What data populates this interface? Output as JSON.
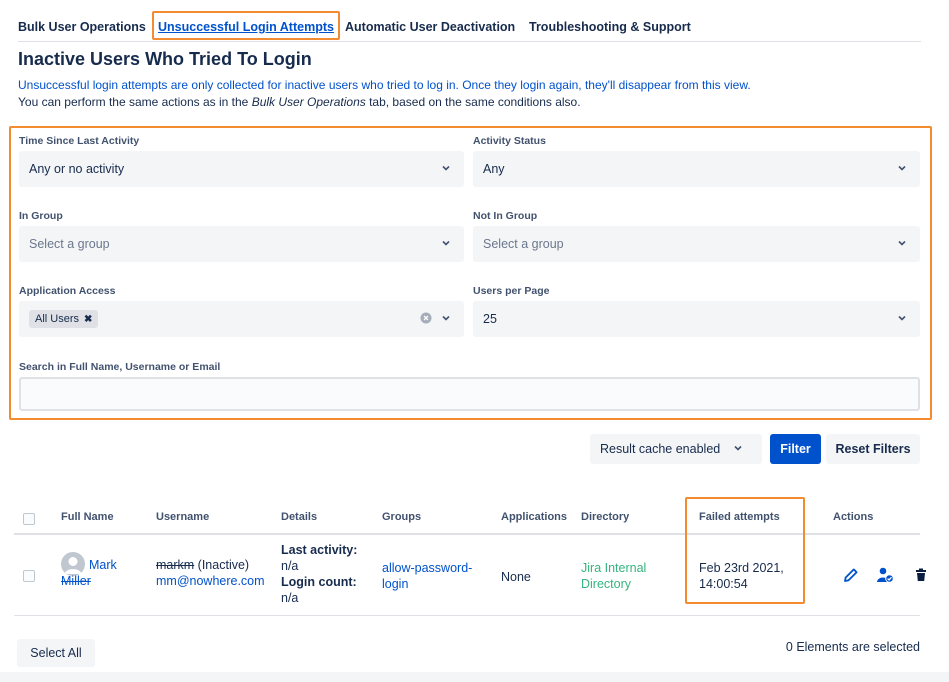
{
  "tabs": [
    {
      "label": "Bulk User Operations",
      "active": false
    },
    {
      "label": "Unsuccessful Login Attempts",
      "active": true
    },
    {
      "label": "Automatic User Deactivation",
      "active": false
    },
    {
      "label": "Troubleshooting & Support",
      "active": false
    }
  ],
  "page": {
    "title": "Inactive Users Who Tried To Login",
    "info_line_1": "Unsuccessful login attempts are only collected for inactive users who tried to log in. Once they login again, they'll disappear from this view.",
    "info_line_2_prefix": "You can perform the same actions as in the ",
    "info_line_2_emph": "Bulk User Operations",
    "info_line_2_suffix": " tab, based on the same conditions also."
  },
  "filters": {
    "time_since_label": "Time Since Last Activity",
    "time_since_value": "Any or no activity",
    "activity_status_label": "Activity Status",
    "activity_status_value": "Any",
    "in_group_label": "In Group",
    "in_group_placeholder": "Select a group",
    "not_in_group_label": "Not In Group",
    "not_in_group_placeholder": "Select a group",
    "app_access_label": "Application Access",
    "app_access_chip": "All Users",
    "users_per_page_label": "Users per Page",
    "users_per_page_value": "25",
    "search_label": "Search in Full Name, Username or Email",
    "search_value": ""
  },
  "toolbar": {
    "cache_label": "Result cache enabled",
    "filter_label": "Filter",
    "reset_label": "Reset Filters"
  },
  "table": {
    "headers": [
      "Full Name",
      "Username",
      "Details",
      "Groups",
      "Applications",
      "Directory",
      "Failed attempts",
      "Actions"
    ],
    "rows": [
      {
        "full_name_first": "Mark",
        "full_name_last": "Miller",
        "username": "markm",
        "username_status": " (Inactive)",
        "email": "mm@nowhere.com",
        "last_activity_label": "Last activity:",
        "last_activity_value": "n/a",
        "login_count_label": "Login count:",
        "login_count_value": "n/a",
        "group_line_1": "allow-password-",
        "group_line_2": "login",
        "applications": "None",
        "directory_line_1": "Jira Internal",
        "directory_line_2": "Directory",
        "failed_line_1": "Feb 23rd 2021,",
        "failed_line_2": "14:00:54"
      }
    ]
  },
  "footer": {
    "select_all_label": "Select All",
    "selected_count": "0 Elements are selected"
  },
  "colors": {
    "link": "#0052cc",
    "highlight": "#f38b31",
    "directory_green": "#36b37e",
    "primary_button": "#0052cc"
  },
  "icons": [
    "chevron-down-icon",
    "clear-icon",
    "edit-icon",
    "user-activate-icon",
    "trash-icon",
    "avatar-icon"
  ]
}
